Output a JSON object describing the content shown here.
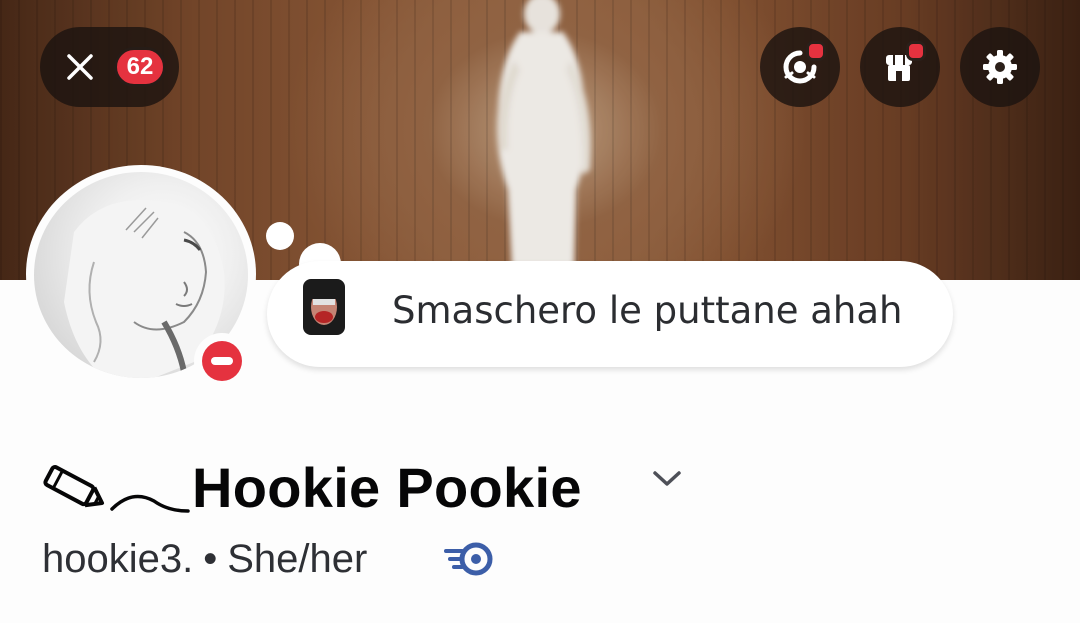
{
  "top_bar": {
    "notification_count": "62"
  },
  "status": {
    "text": "Smaschero le puttane ahah"
  },
  "profile": {
    "display_name": "Hookie Pookie",
    "username": "hookie3.",
    "separator": "•",
    "pronouns": "She/her"
  },
  "icons": {
    "close": "close-icon",
    "quests": "badge-wreath-icon",
    "shop": "shop-icon",
    "settings": "gear-icon",
    "status": "do-not-disturb-icon",
    "name_decoration": "pencil-icon",
    "expand": "chevron-down-icon",
    "nitro": "speed-badge-icon"
  },
  "colors": {
    "accent_red": "#e5323f",
    "badge_blue": "#3c5ea8",
    "text_dark": "#060607"
  }
}
